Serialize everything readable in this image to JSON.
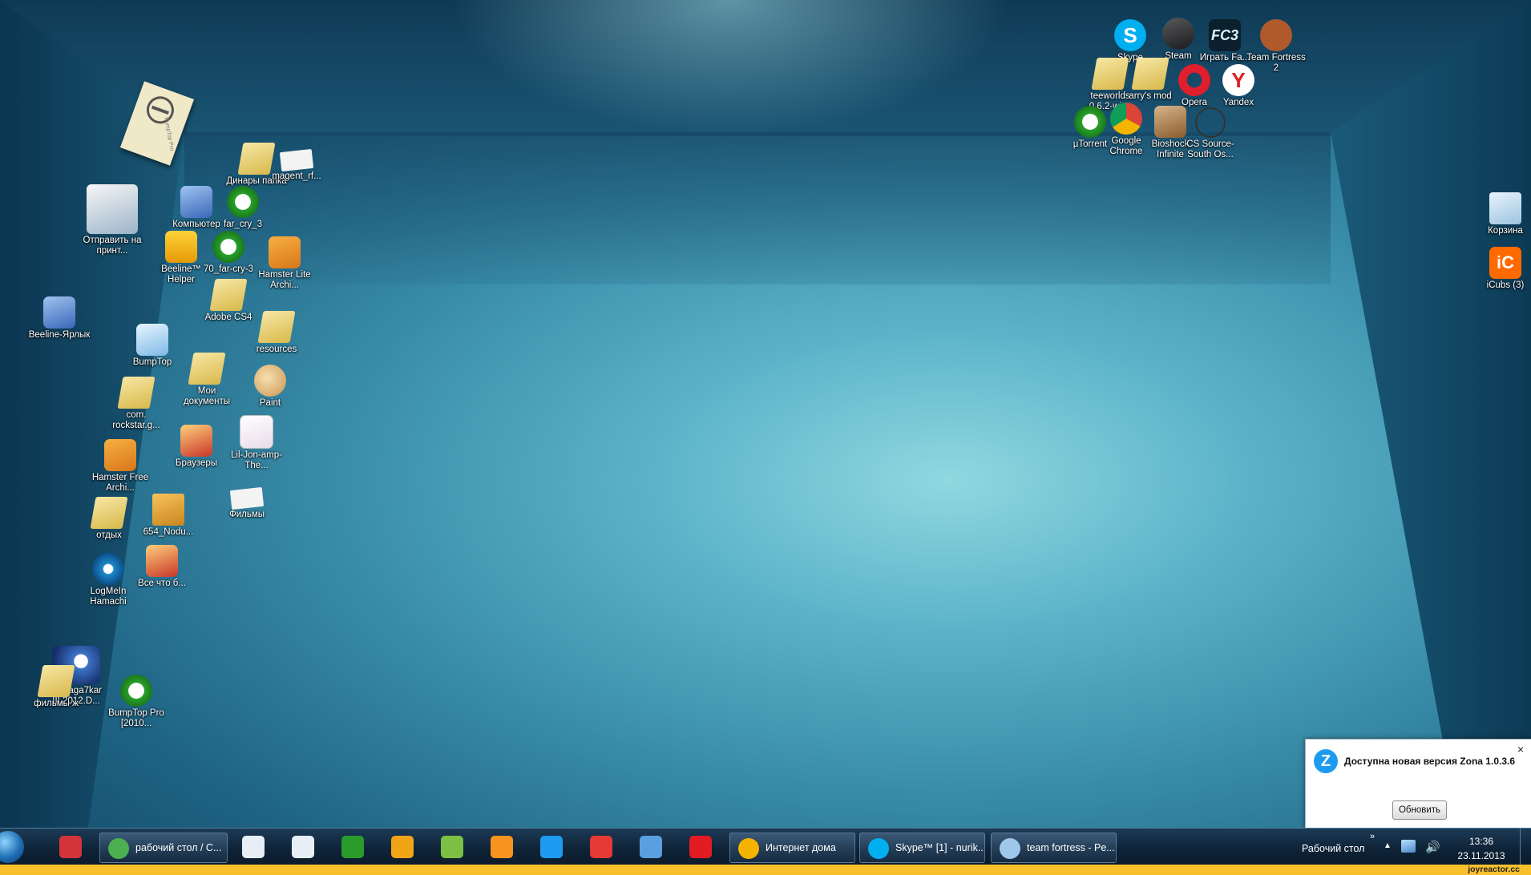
{
  "desktop": {
    "left_icons": [
      {
        "name": "icon-send-to-printer",
        "glyph": "printer",
        "label": "Отправить на принт..."
      },
      {
        "name": "icon-beeline-shortcut",
        "glyph": "pc",
        "label": "Beeline-Ярлык"
      },
      {
        "name": "icon-dinar-folder",
        "glyph": "folder",
        "label": "Динары папка"
      },
      {
        "name": "icon-magent",
        "glyph": "paper",
        "label": "magent_rf..."
      },
      {
        "name": "icon-computer",
        "glyph": "pc",
        "label": "Компьютер"
      },
      {
        "name": "icon-far-cry-3",
        "glyph": "utor",
        "label": "far_cry_3"
      },
      {
        "name": "icon-beeline-helper",
        "glyph": "beeline",
        "label": "Beeline™ Helper"
      },
      {
        "name": "icon-70-far-cry-3",
        "glyph": "utor",
        "label": "70_far-cry-3"
      },
      {
        "name": "icon-hamster-lite",
        "glyph": "ham",
        "label": "Hamster Lite Archi..."
      },
      {
        "name": "icon-adobe-cs4",
        "glyph": "folder",
        "label": "Adobe CS4"
      },
      {
        "name": "icon-resources",
        "glyph": "folder",
        "label": "resources"
      },
      {
        "name": "icon-bumptop",
        "glyph": "bumptop",
        "label": "BumpTop"
      },
      {
        "name": "icon-my-documents",
        "glyph": "folder",
        "label": "Мои документы"
      },
      {
        "name": "icon-paint",
        "glyph": "paint",
        "label": "Paint"
      },
      {
        "name": "icon-rockstar",
        "glyph": "folder",
        "label": "com. rockstar.g..."
      },
      {
        "name": "icon-browsers",
        "glyph": "red",
        "label": "Браузеры"
      },
      {
        "name": "icon-lil-jon",
        "glyph": "mp3",
        "label": "Lil-Jon-amp-The..."
      },
      {
        "name": "icon-hamster-free",
        "glyph": "ham",
        "label": "Hamster Free Archi..."
      },
      {
        "name": "icon-films-paper",
        "glyph": "paper",
        "label": "Фильмы"
      },
      {
        "name": "icon-otdyh",
        "glyph": "folder",
        "label": "отдых"
      },
      {
        "name": "icon-654-nodu",
        "glyph": "box",
        "label": "654_Nodu..."
      },
      {
        "name": "icon-logmein-hamachi",
        "glyph": "hamachi",
        "label": "LogMeIn Hamachi"
      },
      {
        "name": "icon-vse-chto",
        "glyph": "red",
        "label": "Все что б..."
      },
      {
        "name": "icon-ma2aga7kar",
        "glyph": "moon",
        "label": "Ma2aga7kar III.2012.D..."
      },
      {
        "name": "icon-films-zh",
        "glyph": "folder",
        "label": "фильмы ж"
      },
      {
        "name": "icon-bumptop-pro",
        "glyph": "utor",
        "label": "BumpTop Pro [2010..."
      }
    ],
    "top_right_icons": [
      {
        "name": "icon-skype",
        "glyph": "skype",
        "text": "S",
        "label": "Skype"
      },
      {
        "name": "icon-steam",
        "glyph": "steam",
        "text": "",
        "label": "Steam"
      },
      {
        "name": "icon-play-fc3",
        "glyph": "fc3",
        "text": "FC3",
        "label": "Играть Fa..."
      },
      {
        "name": "icon-team-fortress-2",
        "glyph": "tf2",
        "text": "",
        "label": "Team Fortress 2"
      },
      {
        "name": "icon-teeworlds",
        "glyph": "folder",
        "text": "",
        "label": "teeworlds -0.6.2-win..."
      },
      {
        "name": "icon-garrys-mod",
        "glyph": "folder",
        "text": "",
        "label": "arry's mod"
      },
      {
        "name": "icon-opera",
        "glyph": "opera",
        "text": "",
        "label": "Opera"
      },
      {
        "name": "icon-yandex",
        "glyph": "yandex",
        "text": "Y",
        "label": "Yandex"
      },
      {
        "name": "icon-utorrent",
        "glyph": "utor",
        "text": "",
        "label": "µTorrent"
      },
      {
        "name": "icon-google-chrome",
        "glyph": "chrome",
        "text": "",
        "label": "Google Chrome"
      },
      {
        "name": "icon-bioshock",
        "glyph": "bio",
        "text": "",
        "label": "Bioshock Infinite"
      },
      {
        "name": "icon-cs-source",
        "glyph": "cs",
        "text": "",
        "label": "CS Source-South Os..."
      }
    ],
    "right_icons": [
      {
        "name": "icon-recycle-bin",
        "glyph": "bin",
        "text": "",
        "label": "Корзина"
      },
      {
        "name": "icon-icubs",
        "glyph": "icubs",
        "text": "iC",
        "label": "iCubs (3)"
      }
    ],
    "sticky_note": {
      "text": "BumpTop Pro"
    }
  },
  "notification": {
    "icon_letter": "Z",
    "title": "Доступна новая версия Zona 1.0.3.6",
    "close": "×",
    "button": "Обновить"
  },
  "taskbar": {
    "pinned_left": [
      {
        "name": "taskbar-book-icon",
        "color": "#d3343a"
      }
    ],
    "windows": [
      {
        "name": "taskbar-chrome-window",
        "label": "рабочий стол / С...",
        "icon": "#4caf50"
      }
    ],
    "pinned_mid": [
      {
        "name": "taskbar-calendar-icon",
        "color": "#e8eef5"
      },
      {
        "name": "taskbar-calendar2-icon",
        "color": "#e8eef5"
      },
      {
        "name": "taskbar-utorrent-icon",
        "color": "#2a9c2c"
      },
      {
        "name": "taskbar-mail-icon",
        "color": "#f2a417"
      },
      {
        "name": "taskbar-icq-icon",
        "color": "#7bc043"
      },
      {
        "name": "taskbar-odnoklassniki-icon",
        "color": "#f7931e"
      },
      {
        "name": "taskbar-zona-icon",
        "color": "#1d9bf0"
      },
      {
        "name": "taskbar-yandex-icon",
        "color": "#e53935"
      },
      {
        "name": "taskbar-speaker-icon",
        "color": "#5aa0e0"
      },
      {
        "name": "taskbar-yandex-browser-icon",
        "color": "#e31b23"
      }
    ],
    "windows2": [
      {
        "name": "taskbar-internet-doma",
        "label": "Интернет дома",
        "icon": "#f4b400"
      },
      {
        "name": "taskbar-skype-window",
        "label": "Skype™ [1] - nurik...",
        "icon": "#00aff0"
      },
      {
        "name": "taskbar-search-window",
        "label": "team fortress - Pe...",
        "icon": "#9fc7ea"
      }
    ],
    "tray": {
      "desktop_label": "Рабочий стол",
      "chevron": "»",
      "up": "▲",
      "volume": "🔊",
      "time": "13:36",
      "date": "23.11.2013"
    }
  },
  "watermark": "joyreactor.cc"
}
